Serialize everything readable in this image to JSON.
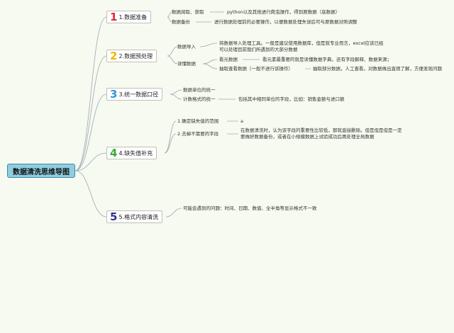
{
  "root": {
    "title": "数据清洗思维导图"
  },
  "branches": [
    {
      "num": "1",
      "title": "1.数据准备",
      "color": "#e5283a",
      "sub": [
        {
          "label": "数据阅取、获取",
          "detail": "python以及其他进行爬虫操作，得到原数据（底数据）"
        },
        {
          "label": "数据备份",
          "detail": "进行数据处理前的必要操作，以便数据处理失误后可与原数据对照调整"
        }
      ]
    },
    {
      "num": "2",
      "title": "2.数据预处理",
      "color": "#f2b600",
      "sub": [
        {
          "label": "数据导入",
          "detail": "将数据导入处理工具。一般是建议使用数据库，但是就专业而言，excel应该已经",
          "detail2": "可以处理目前我们所遇到的大部分数据"
        },
        {
          "label": "读懂数据",
          "items": [
            {
              "label": "看元数据",
              "detail": "看元素最重要的就是读懂数据字典，还有字段解释、数据来源；"
            },
            {
              "label": "抽取查看数据（一般不进行该操作）",
              "detail": "抽取部分数据，人工查看，对数据做出直观了解，方便发现问题"
            }
          ]
        }
      ]
    },
    {
      "num": "3",
      "title": "3.统一数据口径",
      "color": "#2d9ad8",
      "sub": [
        {
          "label": "数据单位的统一"
        },
        {
          "label": "计数格式的统一",
          "detail": "包括其中相同单位的字段，比如：销售金额与进口额"
        }
      ]
    },
    {
      "num": "4",
      "title": "4.缺失值补充",
      "color": "#3aaa35",
      "sub": [
        {
          "label": "1.确定缺失值的范围",
          "detail": "a"
        },
        {
          "label": "2.去掉不需要的字段",
          "detail": "在数据清洗时，认为该字段的重要性比较低，那就直接删除。但是但是但是一定",
          "detail2": "要做好数据备份，或者在小规模数据上试验成功后再处理全局数据"
        }
      ]
    },
    {
      "num": "5",
      "title": "5.格式内容清洗",
      "color": "#2e3192",
      "sub": [
        {
          "label": "可能会遇到的问题：时间、日期、数值、全半角等显示格式不一致"
        }
      ]
    }
  ],
  "colors": {
    "line": "#9aa7b3",
    "root_fill": "#8fcde0"
  }
}
